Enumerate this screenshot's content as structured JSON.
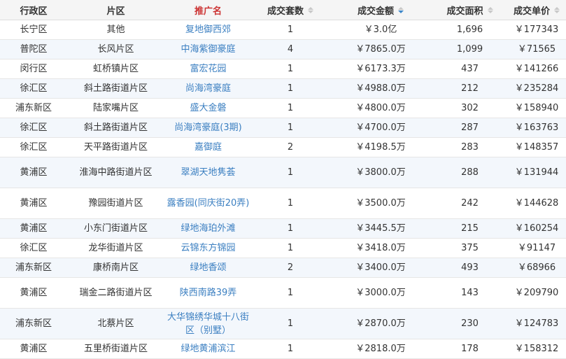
{
  "table": {
    "headers": [
      {
        "label": "行政区",
        "sortable": false
      },
      {
        "label": "片区",
        "sortable": false
      },
      {
        "label": "推广名",
        "sortable": false,
        "highlight": true
      },
      {
        "label": "成交套数",
        "sortable": true
      },
      {
        "label": "成交金额",
        "sortable": true,
        "active_sort": "desc"
      },
      {
        "label": "成交面积",
        "sortable": true
      },
      {
        "label": "成交单价",
        "sortable": true
      }
    ],
    "rows": [
      {
        "district": "长宁区",
        "area": "其他",
        "name": "复地御西郊",
        "units": "1",
        "amount": "￥3.0亿",
        "size": "1,696",
        "price": "￥177343"
      },
      {
        "district": "普陀区",
        "area": "长风片区",
        "name": "中海紫御豪庭",
        "units": "4",
        "amount": "￥7865.0万",
        "size": "1,099",
        "price": "￥71565"
      },
      {
        "district": "闵行区",
        "area": "虹桥镇片区",
        "name": "富宏花园",
        "units": "1",
        "amount": "￥6173.3万",
        "size": "437",
        "price": "￥141266"
      },
      {
        "district": "徐汇区",
        "area": "斜土路街道片区",
        "name": "尚海湾豪庭",
        "units": "1",
        "amount": "￥4988.0万",
        "size": "212",
        "price": "￥235284"
      },
      {
        "district": "浦东新区",
        "area": "陆家嘴片区",
        "name": "盛大金磐",
        "units": "1",
        "amount": "￥4800.0万",
        "size": "302",
        "price": "￥158940"
      },
      {
        "district": "徐汇区",
        "area": "斜土路街道片区",
        "name": "尚海湾豪庭(3期)",
        "units": "1",
        "amount": "￥4700.0万",
        "size": "287",
        "price": "￥163763"
      },
      {
        "district": "徐汇区",
        "area": "天平路街道片区",
        "name": "嘉御庭",
        "units": "2",
        "amount": "￥4198.5万",
        "size": "283",
        "price": "￥148357"
      },
      {
        "district": "黄浦区",
        "area": "淮海中路街道片区",
        "name": "翠湖天地隽荟",
        "units": "1",
        "amount": "￥3800.0万",
        "size": "288",
        "price": "￥131944"
      },
      {
        "district": "黄浦区",
        "area": "豫园街道片区",
        "name": "露香园(同庆街20弄)",
        "units": "1",
        "amount": "￥3500.0万",
        "size": "242",
        "price": "￥144628"
      },
      {
        "district": "黄浦区",
        "area": "小东门街道片区",
        "name": "绿地海珀外滩",
        "units": "1",
        "amount": "￥3445.5万",
        "size": "215",
        "price": "￥160254"
      },
      {
        "district": "徐汇区",
        "area": "龙华街道片区",
        "name": "云锦东方锦园",
        "units": "1",
        "amount": "￥3418.0万",
        "size": "375",
        "price": "￥91147"
      },
      {
        "district": "浦东新区",
        "area": "康桥南片区",
        "name": "绿地香颂",
        "units": "2",
        "amount": "￥3400.0万",
        "size": "493",
        "price": "￥68966"
      },
      {
        "district": "黄浦区",
        "area": "瑞金二路街道片区",
        "name": "陕西南路39弄",
        "units": "1",
        "amount": "￥3000.0万",
        "size": "143",
        "price": "￥209790"
      },
      {
        "district": "浦东新区",
        "area": "北蔡片区",
        "name": "大华锦绣华城十八街区（别墅）",
        "units": "1",
        "amount": "￥2870.0万",
        "size": "230",
        "price": "￥124783"
      },
      {
        "district": "黄浦区",
        "area": "五里桥街道片区",
        "name": "绿地黄浦滨江",
        "units": "1",
        "amount": "￥2818.0万",
        "size": "178",
        "price": "￥158312"
      }
    ]
  }
}
